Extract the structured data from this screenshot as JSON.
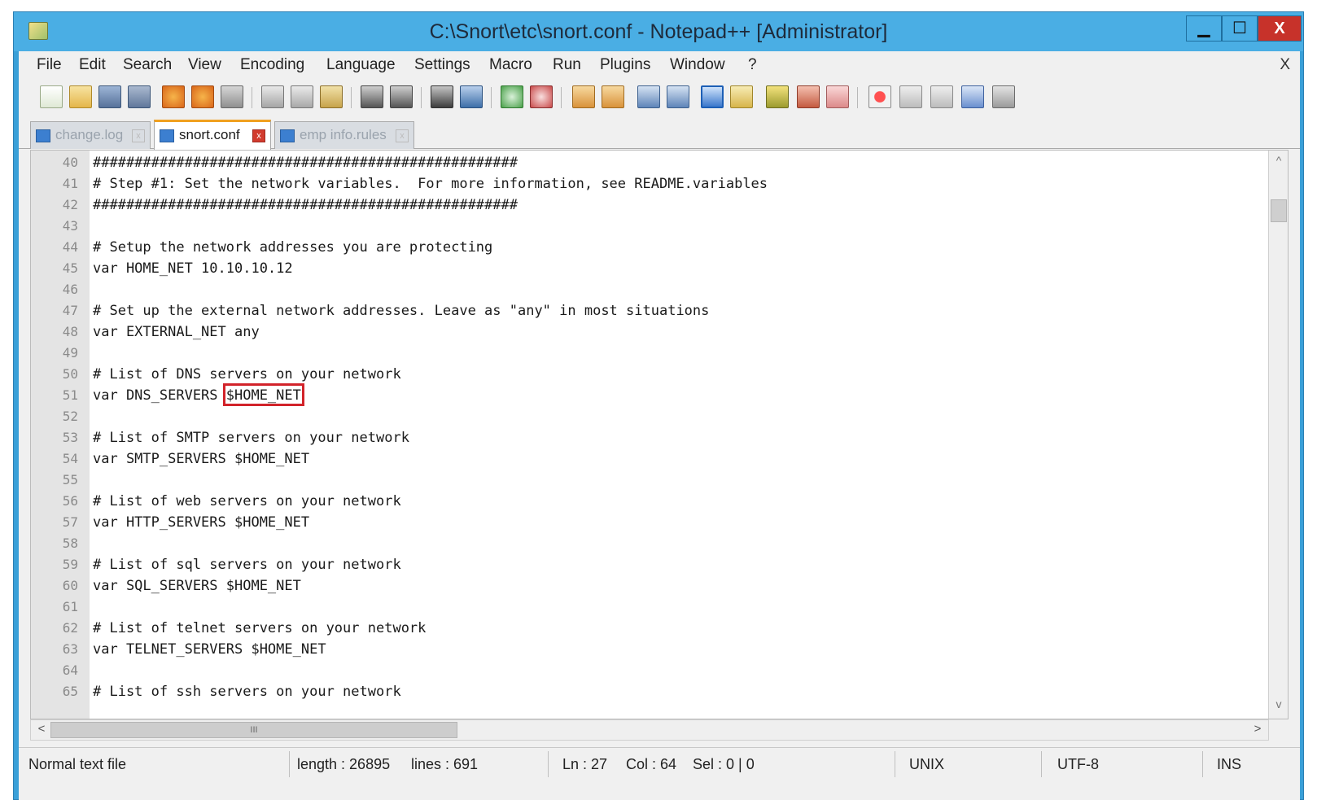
{
  "window": {
    "title": "C:\\Snort\\etc\\snort.conf - Notepad++ [Administrator]",
    "minimize": "▁",
    "maximize": "☐",
    "close": "X"
  },
  "menu": {
    "items": [
      "File",
      "Edit",
      "Search",
      "View",
      "Encoding",
      "Language",
      "Settings",
      "Macro",
      "Run",
      "Plugins",
      "Window",
      "?"
    ],
    "close": "X"
  },
  "tabs": [
    {
      "label": "change.log",
      "active": false
    },
    {
      "label": "snort.conf",
      "active": true
    },
    {
      "label": "emp info.rules",
      "active": false
    }
  ],
  "editor": {
    "lines": [
      {
        "num": "40",
        "text": "###################################################"
      },
      {
        "num": "41",
        "text": "# Step #1: Set the network variables.  For more information, see README.variables"
      },
      {
        "num": "42",
        "text": "###################################################"
      },
      {
        "num": "43",
        "text": ""
      },
      {
        "num": "44",
        "text": "# Setup the network addresses you are protecting"
      },
      {
        "num": "45",
        "text": "var HOME_NET 10.10.10.12"
      },
      {
        "num": "46",
        "text": ""
      },
      {
        "num": "47",
        "text": "# Set up the external network addresses. Leave as \"any\" in most situations"
      },
      {
        "num": "48",
        "text": "var EXTERNAL_NET any"
      },
      {
        "num": "49",
        "text": ""
      },
      {
        "num": "50",
        "text": "# List of DNS servers on your network"
      },
      {
        "num": "51",
        "text": "var DNS_SERVERS $HOME_NET"
      },
      {
        "num": "52",
        "text": ""
      },
      {
        "num": "53",
        "text": "# List of SMTP servers on your network"
      },
      {
        "num": "54",
        "text": "var SMTP_SERVERS $HOME_NET"
      },
      {
        "num": "55",
        "text": ""
      },
      {
        "num": "56",
        "text": "# List of web servers on your network"
      },
      {
        "num": "57",
        "text": "var HTTP_SERVERS $HOME_NET"
      },
      {
        "num": "58",
        "text": ""
      },
      {
        "num": "59",
        "text": "# List of sql servers on your network"
      },
      {
        "num": "60",
        "text": "var SQL_SERVERS $HOME_NET"
      },
      {
        "num": "61",
        "text": ""
      },
      {
        "num": "62",
        "text": "# List of telnet servers on your network"
      },
      {
        "num": "63",
        "text": "var TELNET_SERVERS $HOME_NET"
      },
      {
        "num": "64",
        "text": ""
      },
      {
        "num": "65",
        "text": "# List of ssh servers on your network"
      }
    ],
    "highlight_line_index": 11,
    "highlight_color": "#d2232a"
  },
  "scroll": {
    "up": "^",
    "down": "v",
    "left": "<",
    "right": ">",
    "thumb_grip": "III"
  },
  "status": {
    "file_type": "Normal text file",
    "length": "length : 26895",
    "lines": "lines : 691",
    "ln": "Ln : 27",
    "col": "Col : 64",
    "sel": "Sel : 0 | 0",
    "eol": "UNIX",
    "encoding": "UTF-8",
    "mode": "INS"
  }
}
